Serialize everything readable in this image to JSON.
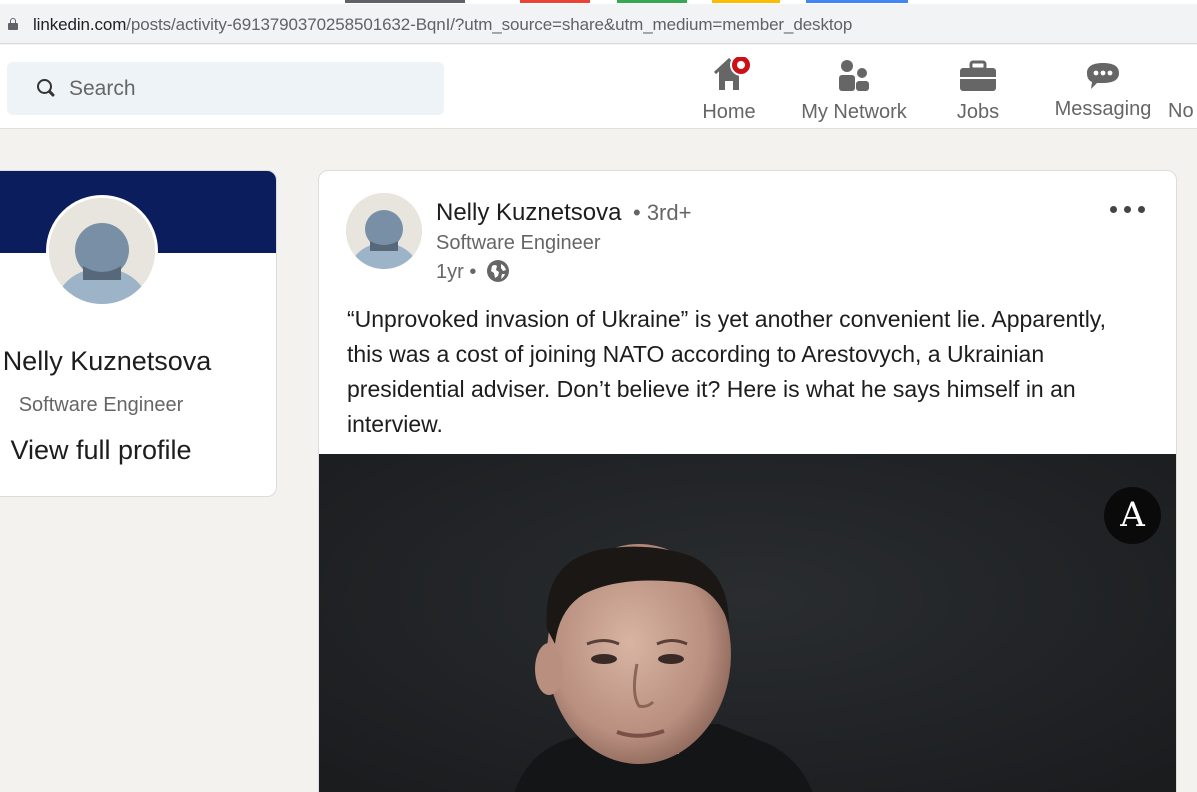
{
  "browser": {
    "url_host": "linkedin.com",
    "url_path": "/posts/activity-6913790370258501632-BqnI/?utm_source=share&utm_medium=member_desktop",
    "tab_strip_colors": [
      "#5f6368",
      "#ea4335",
      "#34a853",
      "#fbbc04",
      "#4285f4"
    ]
  },
  "nav": {
    "search_placeholder": "Search",
    "items": [
      {
        "label": "Home",
        "icon": "home-icon",
        "has_notification": true
      },
      {
        "label": "My Network",
        "icon": "my-network-icon"
      },
      {
        "label": "Jobs",
        "icon": "briefcase-icon"
      },
      {
        "label": "Messaging",
        "icon": "chat-bubble-icon"
      },
      {
        "label": "No",
        "icon": "bell-icon"
      }
    ]
  },
  "profile_card": {
    "name": "Nelly Kuznetsova",
    "title": "Software Engineer",
    "link": "View full profile"
  },
  "post": {
    "author": "Nelly Kuznetsova",
    "degree": "• 3rd+",
    "title": "Software Engineer",
    "time": "1yr •",
    "text": "“Unprovoked invasion of Ukraine” is yet another convenient lie. Apparently, this was a cost of joining NATO according to Arestovych, a Ukrainian presidential adviser. Don’t believe it? Here is what he says himself in an interview.",
    "video_logo": "A"
  },
  "colors": {
    "brand_navy": "#0b1d5c",
    "notification_red": "#cc1016",
    "page_bg": "#f3f2ef"
  }
}
